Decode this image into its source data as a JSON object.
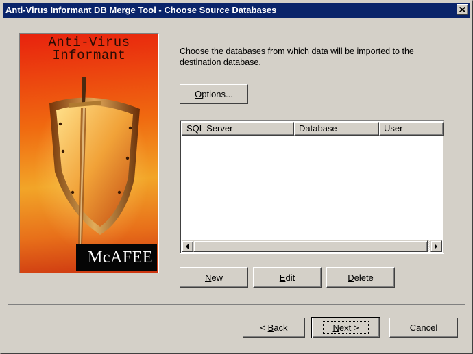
{
  "window": {
    "title": "Anti-Virus Informant DB Merge Tool - Choose Source Databases"
  },
  "art": {
    "title_line1": "Anti-Virus",
    "title_line2": "Informant",
    "brand": "McAFEE",
    "image_icon": "sword-shield-icon"
  },
  "instruction": "Choose the databases from which data will be imported to the destination database.",
  "options_button": {
    "prefix": "",
    "mnemonic": "O",
    "rest": "ptions..."
  },
  "list": {
    "columns": [
      "SQL Server",
      "Database",
      "User"
    ],
    "rows": []
  },
  "actions": {
    "new": {
      "mnemonic": "N",
      "rest": "ew"
    },
    "edit": {
      "mnemonic": "E",
      "rest": "dit"
    },
    "delete": {
      "mnemonic": "D",
      "rest": "elete"
    }
  },
  "nav": {
    "back": {
      "prefix": "< ",
      "mnemonic": "B",
      "rest": "ack"
    },
    "next": {
      "mnemonic": "N",
      "rest": "ext >"
    },
    "cancel": "Cancel"
  },
  "colors": {
    "titlebar": "#0a246a",
    "face": "#d4d0c8"
  }
}
